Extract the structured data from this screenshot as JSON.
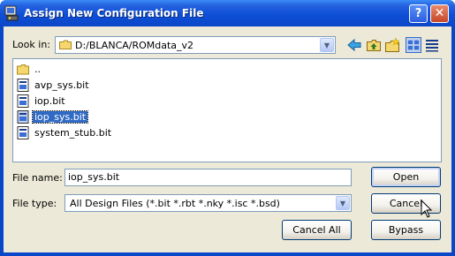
{
  "window": {
    "title": "Assign New Configuration File",
    "help_button": "?",
    "close_button": "✕"
  },
  "lookin": {
    "label": "Look in:",
    "path": "D:/BLANCA/ROMdata_v2"
  },
  "files": [
    {
      "name": "..",
      "type": "folder",
      "selected": false
    },
    {
      "name": "avp_sys.bit",
      "type": "file",
      "selected": false
    },
    {
      "name": "iop.bit",
      "type": "file",
      "selected": false
    },
    {
      "name": "iop_sys.bit",
      "type": "file",
      "selected": true
    },
    {
      "name": "system_stub.bit",
      "type": "file",
      "selected": false
    }
  ],
  "filename": {
    "label": "File name:",
    "value": "iop_sys.bit"
  },
  "filetype": {
    "label": "File type:",
    "value": "All Design Files (*.bit *.rbt *.nky *.isc *.bsd)"
  },
  "buttons": {
    "open": "Open",
    "cancel": "Cancel",
    "cancel_all": "Cancel All",
    "bypass": "Bypass"
  },
  "colors": {
    "titlebar": "#0a46c8",
    "selection": "#316ac5",
    "dialog_bg": "#ece9d8"
  }
}
